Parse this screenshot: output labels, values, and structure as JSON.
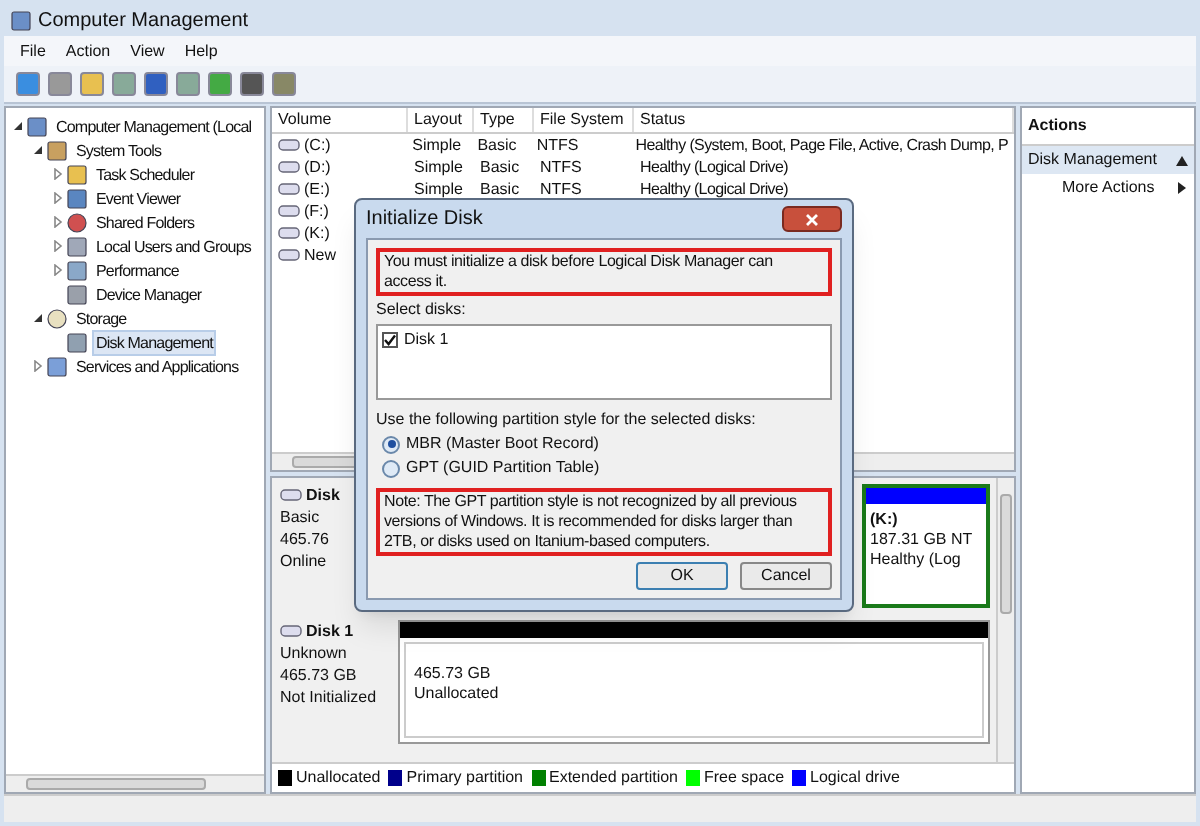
{
  "window": {
    "title": "Computer Management"
  },
  "menu": [
    "File",
    "Action",
    "View",
    "Help"
  ],
  "tree": [
    {
      "label": "Computer Management (Local",
      "expanded": true,
      "selected": false,
      "children": [
        {
          "label": "System Tools",
          "expanded": true,
          "selected": false,
          "children": [
            {
              "label": "Task Scheduler",
              "expanded": false,
              "selected": false
            },
            {
              "label": "Event Viewer",
              "expanded": false,
              "selected": false
            },
            {
              "label": "Shared Folders",
              "expanded": false,
              "selected": false
            },
            {
              "label": "Local Users and Groups",
              "expanded": false,
              "selected": false
            },
            {
              "label": "Performance",
              "expanded": false,
              "selected": false
            },
            {
              "label": "Device Manager",
              "selected": false
            }
          ]
        },
        {
          "label": "Storage",
          "expanded": true,
          "selected": false,
          "children": [
            {
              "label": "Disk Management",
              "selected": true
            }
          ]
        },
        {
          "label": "Services and Applications",
          "expanded": false,
          "selected": false
        }
      ]
    }
  ],
  "volumes": {
    "columns": [
      "Volume",
      "Layout",
      "Type",
      "File System",
      "Status"
    ],
    "rows": [
      {
        "volume": "(C:)",
        "layout": "Simple",
        "type": "Basic",
        "file_system": "NTFS",
        "status": "Healthy (System, Boot, Page File, Active, Crash Dump, P"
      },
      {
        "volume": "(D:)",
        "layout": "Simple",
        "type": "Basic",
        "file_system": "NTFS",
        "status": "Healthy (Logical Drive)"
      },
      {
        "volume": "(E:)",
        "layout": "Simple",
        "type": "Basic",
        "file_system": "NTFS",
        "status": "Healthy (Logical Drive)"
      },
      {
        "volume": "(F:)"
      },
      {
        "volume": "(K:)"
      },
      {
        "volume": "New"
      }
    ]
  },
  "disks": [
    {
      "name": "Disk",
      "lines": [
        "Basic",
        "465.76",
        "Online"
      ],
      "partition": {
        "title": "(K:)",
        "lines": [
          "187.31 GB NT",
          "Healthy (Log"
        ],
        "color": "#0000ff"
      }
    },
    {
      "name": "Disk 1",
      "lines": [
        "Unknown",
        "465.73 GB",
        "Not Initialized"
      ],
      "partition": {
        "lines": [
          "465.73 GB",
          "Unallocated"
        ],
        "color": "#000000"
      }
    }
  ],
  "legend": [
    {
      "label": "Unallocated",
      "color": "#000000"
    },
    {
      "label": "Primary partition",
      "color": "#00008b"
    },
    {
      "label": "Extended partition",
      "color": "#008000"
    },
    {
      "label": "Free space",
      "color": "#00ff00"
    },
    {
      "label": "Logical drive",
      "color": "#0000ff"
    }
  ],
  "actions": {
    "title": "Actions",
    "sections": [
      {
        "label": "Disk Management",
        "expanded": true,
        "items": [
          "More Actions"
        ]
      }
    ]
  },
  "dialog": {
    "title": "Initialize Disk",
    "message": "You must initialize a disk before Logical Disk Manager can access it.",
    "select_label": "Select disks:",
    "disks": [
      {
        "label": "Disk 1",
        "checked": true
      }
    ],
    "style_label": "Use the following partition style for the selected disks:",
    "styles": [
      {
        "label": "MBR (Master Boot Record)",
        "selected": true
      },
      {
        "label": "GPT (GUID Partition Table)",
        "selected": false
      }
    ],
    "note": "Note: The GPT partition style is not recognized by all previous versions of Windows. It is recommended for disks larger than 2TB, or disks used on Itanium-based computers.",
    "buttons": [
      "OK",
      "Cancel"
    ]
  }
}
